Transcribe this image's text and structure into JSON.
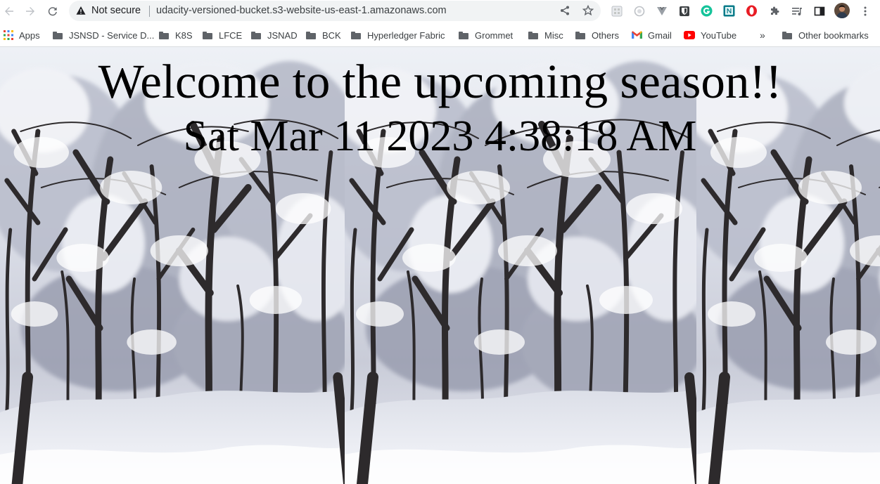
{
  "browser": {
    "security_status": "Not secure",
    "url": "udacity-versioned-bucket.s3-website-us-east-1.amazonaws.com",
    "extensions": [
      "grid-extension-icon",
      "camera-extension-icon",
      "vue-devtools-icon",
      "bitwarden-icon",
      "grammarly-icon",
      "notion-web-clipper-icon",
      "opera-vpn-icon",
      "puzzle-extensions-icon",
      "media-queue-icon",
      "side-panel-icon",
      "profile-avatar"
    ]
  },
  "bookmarks": {
    "apps_label": "Apps",
    "items": [
      {
        "label": "JSNSD - Service D...",
        "icon": "folder-icon"
      },
      {
        "label": "K8S",
        "icon": "folder-icon"
      },
      {
        "label": "LFCE",
        "icon": "folder-icon"
      },
      {
        "label": "JSNAD",
        "icon": "folder-icon"
      },
      {
        "label": "BCK",
        "icon": "folder-icon"
      },
      {
        "label": "Hyperledger Fabric",
        "icon": "folder-icon"
      },
      {
        "label": "Grommet",
        "icon": "folder-icon"
      },
      {
        "label": "Misc",
        "icon": "folder-icon"
      },
      {
        "label": "Others",
        "icon": "folder-icon"
      },
      {
        "label": "Gmail",
        "icon": "gmail-icon"
      },
      {
        "label": "YouTube",
        "icon": "youtube-icon"
      }
    ],
    "overflow_label": "»",
    "other_label": "Other bookmarks"
  },
  "page": {
    "heading": "Welcome to the upcoming season!!",
    "datetime": "Sat Mar 11 2023 4:38:18 AM"
  }
}
